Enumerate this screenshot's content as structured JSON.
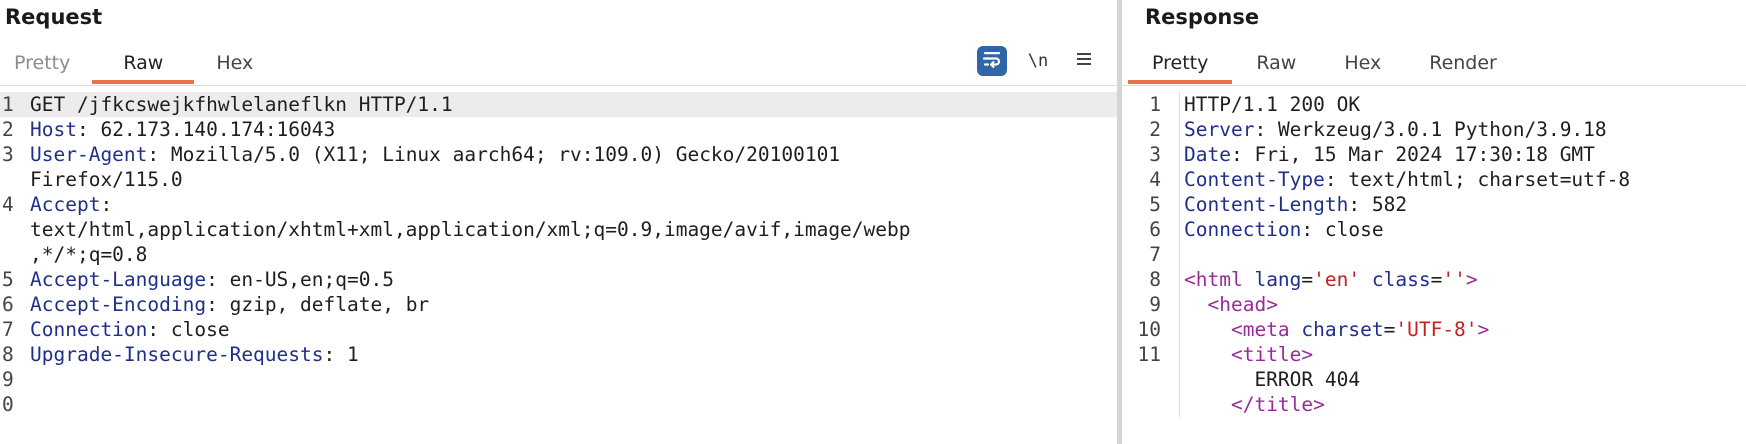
{
  "request": {
    "title": "Request",
    "tabs": [
      "Pretty",
      "Raw",
      "Hex"
    ],
    "active_tab": "Raw",
    "toolbar": {
      "newline_label": "\\n",
      "menu_label": "≡"
    },
    "lines": [
      {
        "n": "1",
        "key": "",
        "sep": "",
        "value": "GET /jfkcswejkfhwlelaneflkn HTTP/1.1"
      },
      {
        "n": "2",
        "key": "Host",
        "sep": ": ",
        "value": "62.173.140.174:16043"
      },
      {
        "n": "3",
        "key": "User-Agent",
        "sep": ": ",
        "value": "Mozilla/5.0 (X11; Linux aarch64; rv:109.0) Gecko/20100101"
      },
      {
        "n": "",
        "key": "",
        "sep": "",
        "value": "Firefox/115.0"
      },
      {
        "n": "4",
        "key": "Accept",
        "sep": ":",
        "value": ""
      },
      {
        "n": "",
        "key": "",
        "sep": "",
        "value": "text/html,application/xhtml+xml,application/xml;q=0.9,image/avif,image/webp"
      },
      {
        "n": "",
        "key": "",
        "sep": "",
        "value": ",*/*;q=0.8"
      },
      {
        "n": "5",
        "key": "Accept-Language",
        "sep": ": ",
        "value": "en-US,en;q=0.5"
      },
      {
        "n": "6",
        "key": "Accept-Encoding",
        "sep": ": ",
        "value": "gzip, deflate, br"
      },
      {
        "n": "7",
        "key": "Connection",
        "sep": ": ",
        "value": "close"
      },
      {
        "n": "8",
        "key": "Upgrade-Insecure-Requests",
        "sep": ": ",
        "value": "1"
      },
      {
        "n": "9",
        "key": "",
        "sep": "",
        "value": ""
      },
      {
        "n": "0",
        "key": "",
        "sep": "",
        "value": ""
      }
    ]
  },
  "response": {
    "title": "Response",
    "tabs": [
      "Pretty",
      "Raw",
      "Hex",
      "Render"
    ],
    "active_tab": "Pretty",
    "lines": [
      {
        "n": "1",
        "text": "HTTP/1.1 200 OK"
      },
      {
        "n": "2",
        "key": "Server",
        "value": "Werkzeug/3.0.1 Python/3.9.18"
      },
      {
        "n": "3",
        "key": "Date",
        "value": "Fri, 15 Mar 2024 17:30:18 GMT"
      },
      {
        "n": "4",
        "key": "Content-Type",
        "value": "text/html; charset=utf-8"
      },
      {
        "n": "5",
        "key": "Content-Length",
        "value": "582"
      },
      {
        "n": "6",
        "key": "Connection",
        "value": "close"
      },
      {
        "n": "7",
        "text": ""
      },
      {
        "n": "8",
        "html": [
          [
            "tag",
            "<html"
          ],
          [
            "text",
            " "
          ],
          [
            "attr",
            "lang"
          ],
          [
            "text",
            "="
          ],
          [
            "str",
            "'en'"
          ],
          [
            "text",
            " "
          ],
          [
            "attr",
            "class"
          ],
          [
            "text",
            "="
          ],
          [
            "str",
            "''"
          ],
          [
            "tag",
            ">"
          ]
        ]
      },
      {
        "n": "9",
        "html": [
          [
            "text",
            "  "
          ],
          [
            "tag",
            "<head"
          ],
          [
            "tag",
            ">"
          ]
        ]
      },
      {
        "n": "10",
        "html": [
          [
            "text",
            "    "
          ],
          [
            "tag",
            "<meta"
          ],
          [
            "text",
            " "
          ],
          [
            "attr",
            "charset"
          ],
          [
            "text",
            "="
          ],
          [
            "str",
            "'UTF-8'"
          ],
          [
            "tag",
            ">"
          ]
        ]
      },
      {
        "n": "11",
        "html": [
          [
            "text",
            "    "
          ],
          [
            "tag",
            "<title"
          ],
          [
            "tag",
            ">"
          ]
        ]
      },
      {
        "n": "",
        "html": [
          [
            "text",
            "      ERROR 404"
          ]
        ]
      },
      {
        "n": "",
        "html": [
          [
            "text",
            "    "
          ],
          [
            "tag",
            "</title"
          ],
          [
            "tag",
            ">"
          ]
        ]
      }
    ]
  },
  "colors": {
    "accent_tab": "#e8734a",
    "wrap_button": "#2f66a8",
    "header_key": "#1f2f8a",
    "html_tag": "#9a2a9a",
    "html_string": "#c42020"
  }
}
